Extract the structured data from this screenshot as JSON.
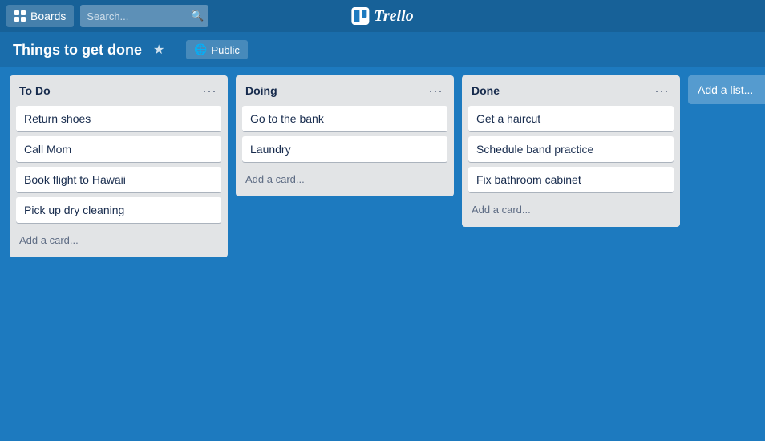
{
  "nav": {
    "boards_label": "Boards",
    "search_placeholder": "Search...",
    "logo_text": "Trello"
  },
  "board": {
    "title": "Things to get done",
    "visibility": "Public"
  },
  "lists": [
    {
      "id": "todo",
      "title": "To Do",
      "cards": [
        {
          "text": "Return shoes"
        },
        {
          "text": "Call Mom"
        },
        {
          "text": "Book flight to Hawaii"
        },
        {
          "text": "Pick up dry cleaning"
        }
      ],
      "add_card_label": "Add a card..."
    },
    {
      "id": "doing",
      "title": "Doing",
      "cards": [
        {
          "text": "Go to the bank"
        },
        {
          "text": "Laundry"
        }
      ],
      "add_card_label": "Add a card..."
    },
    {
      "id": "done",
      "title": "Done",
      "cards": [
        {
          "text": "Get a haircut"
        },
        {
          "text": "Schedule band practice"
        },
        {
          "text": "Fix bathroom cabinet"
        }
      ],
      "add_card_label": "Add a card..."
    }
  ],
  "add_list_label": "Add a list..."
}
